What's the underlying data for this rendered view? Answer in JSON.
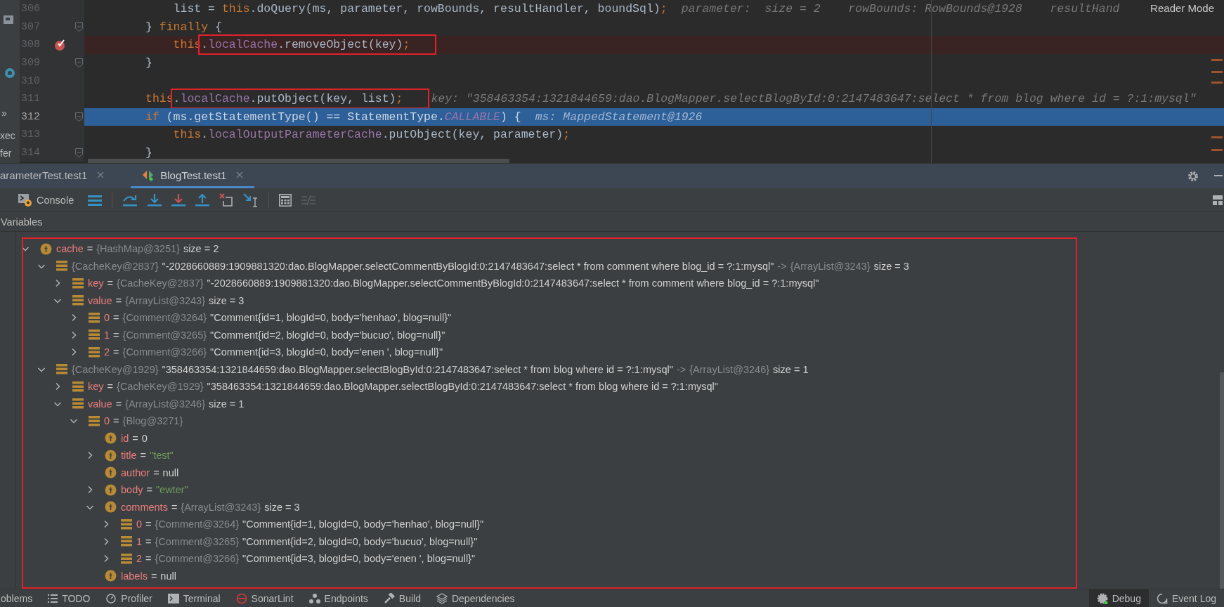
{
  "editor": {
    "side_labels": [
      "»",
      "xec",
      "fer"
    ],
    "reader_mode": "Reader Mode",
    "lines": [
      {
        "number": "306",
        "breakpoint": false,
        "current": false,
        "fold": false,
        "tokens": [
          {
            "text": "    list = ",
            "kind": "plain"
          },
          {
            "text": "this",
            "kind": "keyword"
          },
          {
            "text": ".doQuery(ms, parameter, rowBounds, resultHandler, boundSql)",
            "kind": "plain"
          },
          {
            "text": ";",
            "kind": "keyword"
          }
        ],
        "hint": "parameter:  size = 2    rowBounds: RowBounds@1928    resultHand"
      },
      {
        "number": "307",
        "breakpoint": false,
        "current": false,
        "fold": true,
        "tokens": [
          {
            "text": "} ",
            "kind": "plain"
          },
          {
            "text": "finally",
            "kind": "keyword"
          },
          {
            "text": " {",
            "kind": "plain"
          }
        ]
      },
      {
        "number": "308",
        "breakpoint": true,
        "current": false,
        "fold": false,
        "tokens": [
          {
            "text": "    this",
            "kind": "keyword"
          }
        ],
        "annotation": {
          "tokens": [
            {
              "text": ".",
              "kind": "plain"
            },
            {
              "text": "localCache",
              "kind": "field"
            },
            {
              "text": ".removeObject(key)",
              "kind": "plain"
            },
            {
              "text": ";",
              "kind": "keyword"
            }
          ]
        }
      },
      {
        "number": "309",
        "breakpoint": false,
        "current": false,
        "fold": true,
        "tokens": [
          {
            "text": "}",
            "kind": "plain"
          }
        ]
      },
      {
        "number": "310",
        "breakpoint": false,
        "current": false,
        "fold": false
      },
      {
        "number": "311",
        "breakpoint": false,
        "current": false,
        "fold": false,
        "tokens": [
          {
            "text": "this",
            "kind": "keyword"
          }
        ],
        "annotation": {
          "tokens": [
            {
              "text": ".",
              "kind": "plain"
            },
            {
              "text": "localCache",
              "kind": "field"
            },
            {
              "text": ".putObject(key, list)",
              "kind": "plain"
            },
            {
              "text": ";",
              "kind": "keyword"
            }
          ]
        },
        "hint": "key: \"358463354:1321844659:dao.BlogMapper.selectBlogById:0:2147483647:select * from blog where id = ?:1:mysql\""
      },
      {
        "number": "312",
        "breakpoint": false,
        "current": true,
        "fold": true,
        "tokens": [
          {
            "text": "if",
            "kind": "keyword"
          },
          {
            "text": " (ms.getStatementType() == StatementType.",
            "kind": "plain"
          },
          {
            "text": "CALLABLE",
            "kind": "constant"
          },
          {
            "text": ") {",
            "kind": "plain"
          }
        ],
        "hint": "ms: MappedStatement@1926"
      },
      {
        "number": "313",
        "breakpoint": false,
        "current": false,
        "fold": false,
        "tokens": [
          {
            "text": "    this",
            "kind": "keyword"
          },
          {
            "text": ".",
            "kind": "plain"
          },
          {
            "text": "localOutputParameterCache",
            "kind": "field"
          },
          {
            "text": ".putObject(key, parameter)",
            "kind": "plain"
          },
          {
            "text": ";",
            "kind": "keyword"
          }
        ]
      },
      {
        "number": "314",
        "breakpoint": false,
        "current": false,
        "fold": true,
        "tokens": [
          {
            "text": "}",
            "kind": "plain"
          }
        ]
      }
    ]
  },
  "debug_tabs": [
    {
      "label": "arameterTest.test1",
      "selected": false
    },
    {
      "label": "BlogTest.test1",
      "selected": true
    }
  ],
  "toolbar": {
    "console": "Console"
  },
  "variables": {
    "title": "Variables",
    "annotated": true,
    "tree": [
      {
        "kind": "field",
        "expanded": true,
        "parts": [
          {
            "text": "cache",
            "kind": "name"
          },
          {
            "text": "=",
            "kind": "text"
          },
          {
            "text": "{HashMap@3251}",
            "kind": "type"
          },
          {
            "text": "size = 2",
            "kind": "text"
          }
        ],
        "children": [
          {
            "kind": "element",
            "expanded": true,
            "parts": [
              {
                "text": "{CacheKey@2837}",
                "kind": "type"
              },
              {
                "text": "\"-2028660889:1909881320:dao.BlogMapper.selectCommentByBlogId:0:2147483647:select * from comment where blog_id = ?:1:mysql\"",
                "kind": "text"
              },
              {
                "text": "->",
                "kind": "type"
              },
              {
                "text": "{ArrayList@3243}",
                "kind": "type"
              },
              {
                "text": "size = 3",
                "kind": "text"
              }
            ],
            "children": [
              {
                "kind": "element",
                "expanded": false,
                "parts": [
                  {
                    "text": "key",
                    "kind": "name"
                  },
                  {
                    "text": "=",
                    "kind": "text"
                  },
                  {
                    "text": "{CacheKey@2837}",
                    "kind": "type"
                  },
                  {
                    "text": "\"-2028660889:1909881320:dao.BlogMapper.selectCommentByBlogId:0:2147483647:select * from comment where blog_id = ?:1:mysql\"",
                    "kind": "text"
                  }
                ]
              },
              {
                "kind": "element",
                "expanded": true,
                "parts": [
                  {
                    "text": "value",
                    "kind": "name"
                  },
                  {
                    "text": "=",
                    "kind": "text"
                  },
                  {
                    "text": "{ArrayList@3243}",
                    "kind": "type"
                  },
                  {
                    "text": "size = 3",
                    "kind": "text"
                  }
                ],
                "children": [
                  {
                    "kind": "element",
                    "expanded": false,
                    "parts": [
                      {
                        "text": "0",
                        "kind": "name"
                      },
                      {
                        "text": "=",
                        "kind": "text"
                      },
                      {
                        "text": "{Comment@3264}",
                        "kind": "type"
                      },
                      {
                        "text": "\"Comment{id=1, blogId=0, body='henhao', blog=null}\"",
                        "kind": "text"
                      }
                    ]
                  },
                  {
                    "kind": "element",
                    "expanded": false,
                    "parts": [
                      {
                        "text": "1",
                        "kind": "name"
                      },
                      {
                        "text": "=",
                        "kind": "text"
                      },
                      {
                        "text": "{Comment@3265}",
                        "kind": "type"
                      },
                      {
                        "text": "\"Comment{id=2, blogId=0, body='bucuo', blog=null}\"",
                        "kind": "text"
                      }
                    ]
                  },
                  {
                    "kind": "element",
                    "expanded": false,
                    "parts": [
                      {
                        "text": "2",
                        "kind": "name"
                      },
                      {
                        "text": "=",
                        "kind": "text"
                      },
                      {
                        "text": "{Comment@3266}",
                        "kind": "type"
                      },
                      {
                        "text": "\"Comment{id=3, blogId=0, body='enen ', blog=null}\"",
                        "kind": "text"
                      }
                    ]
                  }
                ]
              }
            ]
          },
          {
            "kind": "element",
            "expanded": true,
            "parts": [
              {
                "text": "{CacheKey@1929}",
                "kind": "type"
              },
              {
                "text": "\"358463354:1321844659:dao.BlogMapper.selectBlogById:0:2147483647:select * from blog where id = ?:1:mysql\"",
                "kind": "text"
              },
              {
                "text": "->",
                "kind": "type"
              },
              {
                "text": "{ArrayList@3246}",
                "kind": "type"
              },
              {
                "text": "size = 1",
                "kind": "text"
              }
            ],
            "children": [
              {
                "kind": "element",
                "expanded": false,
                "parts": [
                  {
                    "text": "key",
                    "kind": "name"
                  },
                  {
                    "text": "=",
                    "kind": "text"
                  },
                  {
                    "text": "{CacheKey@1929}",
                    "kind": "type"
                  },
                  {
                    "text": "\"358463354:1321844659:dao.BlogMapper.selectBlogById:0:2147483647:select * from blog where id = ?:1:mysql\"",
                    "kind": "text"
                  }
                ]
              },
              {
                "kind": "element",
                "expanded": true,
                "parts": [
                  {
                    "text": "value",
                    "kind": "name"
                  },
                  {
                    "text": "=",
                    "kind": "text"
                  },
                  {
                    "text": "{ArrayList@3246}",
                    "kind": "type"
                  },
                  {
                    "text": "size = 1",
                    "kind": "text"
                  }
                ],
                "children": [
                  {
                    "kind": "element",
                    "expanded": true,
                    "parts": [
                      {
                        "text": "0",
                        "kind": "name"
                      },
                      {
                        "text": "=",
                        "kind": "text"
                      },
                      {
                        "text": "{Blog@3271}",
                        "kind": "type"
                      }
                    ],
                    "children": [
                      {
                        "kind": "field",
                        "parts": [
                          {
                            "text": "id",
                            "kind": "name"
                          },
                          {
                            "text": "=",
                            "kind": "text"
                          },
                          {
                            "text": "0",
                            "kind": "text"
                          }
                        ]
                      },
                      {
                        "kind": "field",
                        "expanded": false,
                        "parts": [
                          {
                            "text": "title",
                            "kind": "name"
                          },
                          {
                            "text": "=",
                            "kind": "text"
                          },
                          {
                            "text": "\"test\"",
                            "kind": "string"
                          }
                        ]
                      },
                      {
                        "kind": "field",
                        "parts": [
                          {
                            "text": "author",
                            "kind": "name"
                          },
                          {
                            "text": "=",
                            "kind": "text"
                          },
                          {
                            "text": "null",
                            "kind": "text"
                          }
                        ]
                      },
                      {
                        "kind": "field",
                        "expanded": false,
                        "parts": [
                          {
                            "text": "body",
                            "kind": "name"
                          },
                          {
                            "text": "=",
                            "kind": "text"
                          },
                          {
                            "text": "\"ewter\"",
                            "kind": "string"
                          }
                        ]
                      },
                      {
                        "kind": "field",
                        "expanded": true,
                        "parts": [
                          {
                            "text": "comments",
                            "kind": "name"
                          },
                          {
                            "text": "=",
                            "kind": "text"
                          },
                          {
                            "text": "{ArrayList@3243}",
                            "kind": "type"
                          },
                          {
                            "text": "size = 3",
                            "kind": "text"
                          }
                        ],
                        "children": [
                          {
                            "kind": "element",
                            "expanded": false,
                            "parts": [
                              {
                                "text": "0",
                                "kind": "name"
                              },
                              {
                                "text": "=",
                                "kind": "text"
                              },
                              {
                                "text": "{Comment@3264}",
                                "kind": "type"
                              },
                              {
                                "text": "\"Comment{id=1, blogId=0, body='henhao', blog=null}\"",
                                "kind": "text"
                              }
                            ]
                          },
                          {
                            "kind": "element",
                            "expanded": false,
                            "parts": [
                              {
                                "text": "1",
                                "kind": "name"
                              },
                              {
                                "text": "=",
                                "kind": "text"
                              },
                              {
                                "text": "{Comment@3265}",
                                "kind": "type"
                              },
                              {
                                "text": "\"Comment{id=2, blogId=0, body='bucuo', blog=null}\"",
                                "kind": "text"
                              }
                            ]
                          },
                          {
                            "kind": "element",
                            "expanded": false,
                            "parts": [
                              {
                                "text": "2",
                                "kind": "name"
                              },
                              {
                                "text": "=",
                                "kind": "text"
                              },
                              {
                                "text": "{Comment@3266}",
                                "kind": "type"
                              },
                              {
                                "text": "\"Comment{id=3, blogId=0, body='enen ', blog=null}\"",
                                "kind": "text"
                              }
                            ]
                          }
                        ]
                      },
                      {
                        "kind": "field",
                        "parts": [
                          {
                            "text": "labels",
                            "kind": "name"
                          },
                          {
                            "text": "=",
                            "kind": "text"
                          },
                          {
                            "text": "null",
                            "kind": "text"
                          }
                        ]
                      }
                    ]
                  }
                ]
              }
            ]
          }
        ]
      }
    ]
  },
  "status_bar": {
    "left": [
      {
        "label": "oblems",
        "selected": false
      },
      {
        "label": "TODO",
        "selected": false
      },
      {
        "label": "Profiler",
        "selected": false
      },
      {
        "label": "Terminal",
        "selected": false
      },
      {
        "label": "SonarLint",
        "selected": false
      },
      {
        "label": "Endpoints",
        "selected": false
      },
      {
        "label": "Build",
        "selected": false
      },
      {
        "label": "Dependencies",
        "selected": false
      }
    ],
    "right": [
      {
        "label": "Debug",
        "selected": true
      },
      {
        "label": "Event Log",
        "selected": false
      }
    ]
  }
}
